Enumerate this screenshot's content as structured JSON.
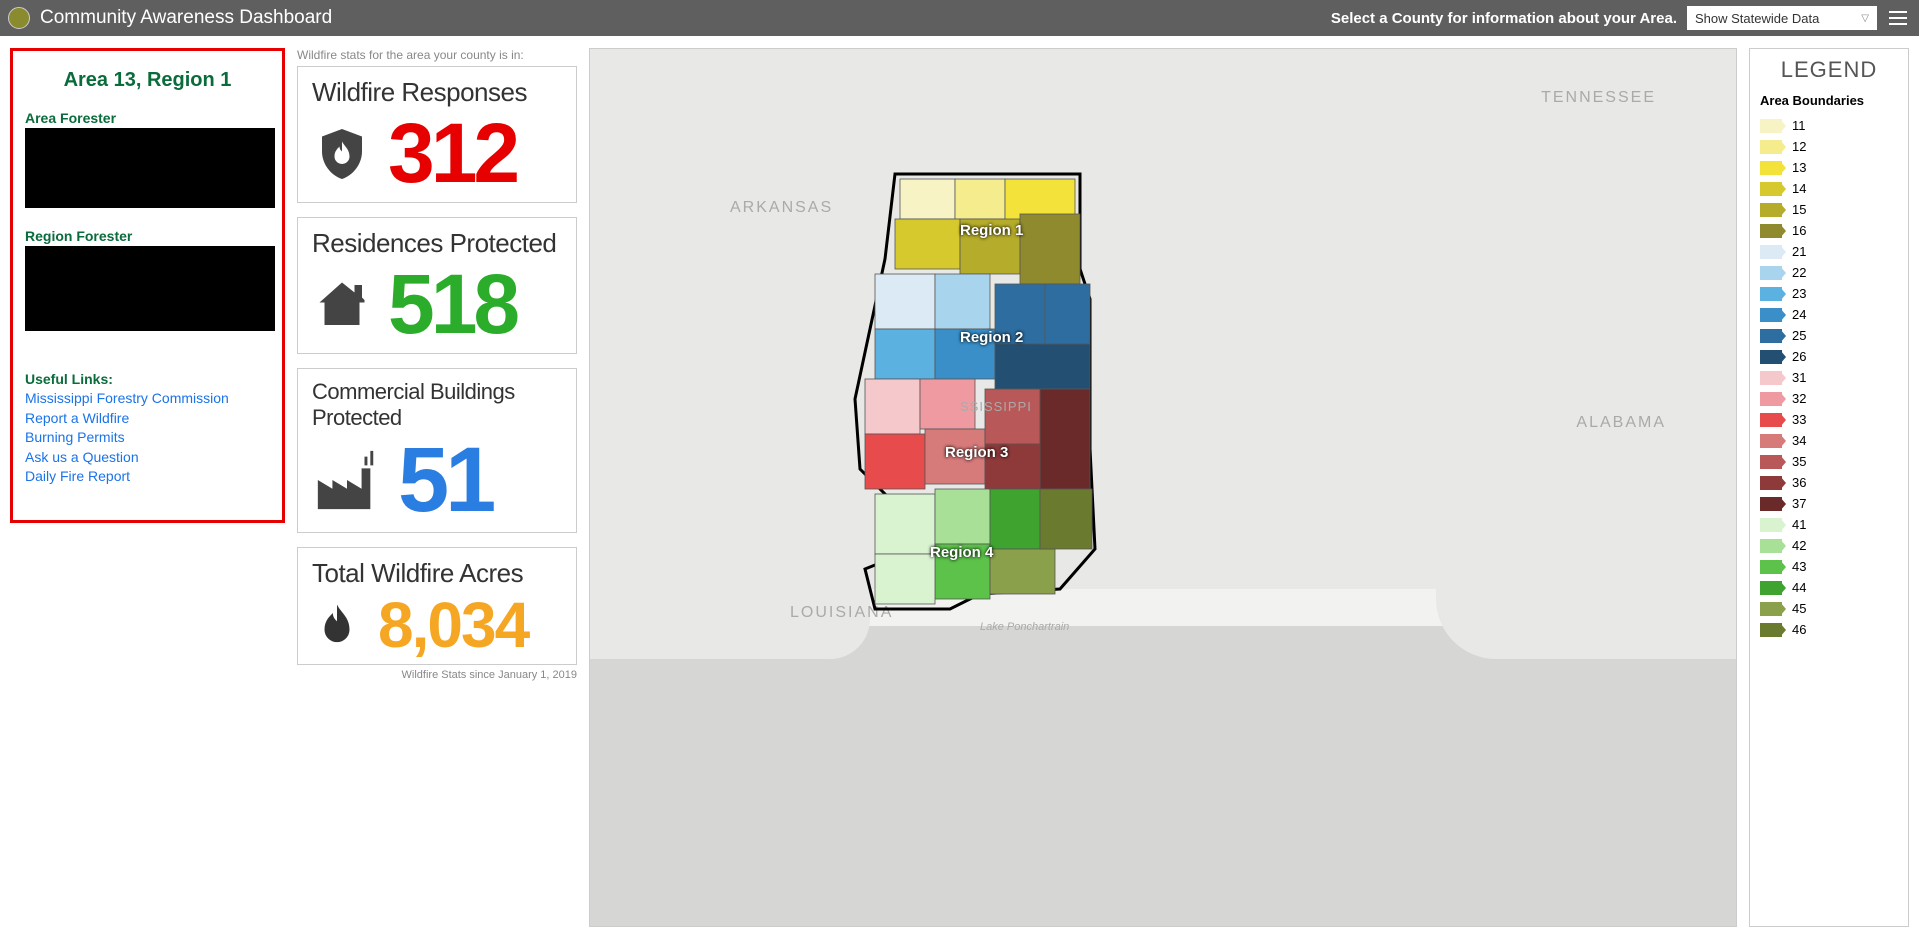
{
  "header": {
    "title": "Community Awareness Dashboard",
    "prompt": "Select a County for information about your Area.",
    "dropdown_label": "Show Statewide Data"
  },
  "area_panel": {
    "title": "Area 13, Region 1",
    "area_forester_label": "Area Forester",
    "region_forester_label": "Region Forester",
    "useful_links_label": "Useful Links:",
    "links": [
      "Mississippi Forestry Commission",
      "Report a Wildfire",
      "Burning Permits",
      "Ask us a Question",
      "Daily Fire Report"
    ]
  },
  "stats": {
    "note": "Wildfire stats for the area your county is in:",
    "wildfire_responses": {
      "title": "Wildfire Responses",
      "value": "312"
    },
    "residences_protected": {
      "title": "Residences Protected",
      "value": "518"
    },
    "commercial_protected": {
      "title": "Commercial Buildings Protected",
      "value": "51"
    },
    "total_acres": {
      "title": "Total Wildfire Acres",
      "value": "8,034"
    },
    "footnote": "Wildfire Stats since January 1, 2019"
  },
  "map": {
    "state_labels": {
      "tennessee": "TENNESSEE",
      "arkansas": "ARKANSAS",
      "alabama": "ALABAMA",
      "louisiana": "LOUISIANA",
      "mississippi_partial": "SSISSIPPI"
    },
    "water_label": "Lake Ponchartrain",
    "regions": [
      {
        "label": "Region 1"
      },
      {
        "label": "Region 2"
      },
      {
        "label": "Region 3"
      },
      {
        "label": "Region 4"
      }
    ]
  },
  "legend": {
    "title": "LEGEND",
    "subtitle": "Area Boundaries",
    "items": [
      {
        "num": "11",
        "color": "#f7f3c5"
      },
      {
        "num": "12",
        "color": "#f5ec8e"
      },
      {
        "num": "13",
        "color": "#f2e23a"
      },
      {
        "num": "14",
        "color": "#d6c92e"
      },
      {
        "num": "15",
        "color": "#b5ac2b"
      },
      {
        "num": "16",
        "color": "#8f8a2e"
      },
      {
        "num": "21",
        "color": "#dceaf5"
      },
      {
        "num": "22",
        "color": "#a9d4ed"
      },
      {
        "num": "23",
        "color": "#5bb2e0"
      },
      {
        "num": "24",
        "color": "#3a8fc9"
      },
      {
        "num": "25",
        "color": "#2e6da0"
      },
      {
        "num": "26",
        "color": "#234f73"
      },
      {
        "num": "31",
        "color": "#f5c9cc"
      },
      {
        "num": "32",
        "color": "#ef9aa0"
      },
      {
        "num": "33",
        "color": "#e84b4b"
      },
      {
        "num": "34",
        "color": "#d77a7a"
      },
      {
        "num": "35",
        "color": "#b85858"
      },
      {
        "num": "36",
        "color": "#8f3a3a"
      },
      {
        "num": "37",
        "color": "#6b2a2a"
      },
      {
        "num": "41",
        "color": "#d9f2d0"
      },
      {
        "num": "42",
        "color": "#a8e098"
      },
      {
        "num": "43",
        "color": "#5cc24a"
      },
      {
        "num": "44",
        "color": "#3fa330"
      },
      {
        "num": "45",
        "color": "#8aa04a"
      },
      {
        "num": "46",
        "color": "#6a7a2e"
      }
    ]
  }
}
